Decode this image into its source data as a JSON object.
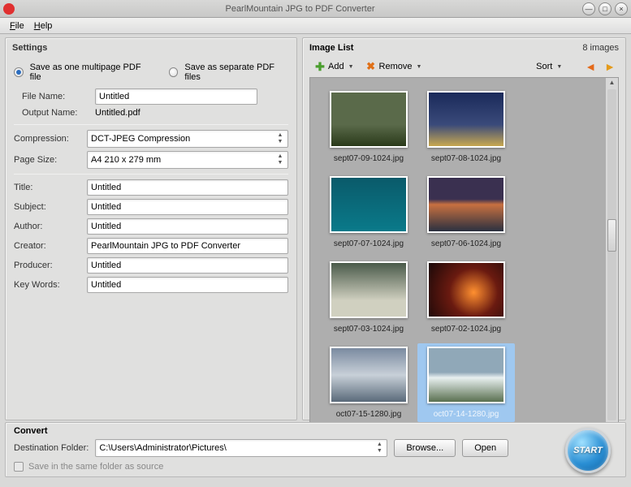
{
  "window": {
    "title": "PearlMountain JPG to PDF Converter"
  },
  "menu": {
    "file": "File",
    "help": "Help"
  },
  "settings": {
    "title": "Settings",
    "radio_multipage": "Save as one multipage PDF file",
    "radio_separate": "Save as separate PDF files",
    "filename_label": "File Name:",
    "filename_value": "Untitled",
    "outputname_label": "Output Name:",
    "outputname_value": "Untitled.pdf",
    "compression_label": "Compression:",
    "compression_value": "DCT-JPEG Compression",
    "pagesize_label": "Page Size:",
    "pagesize_value": "A4 210 x 279 mm",
    "title_label": "Title:",
    "title_value": "Untitled",
    "subject_label": "Subject:",
    "subject_value": "Untitled",
    "author_label": "Author:",
    "author_value": "Untitled",
    "creator_label": "Creator:",
    "creator_value": "PearlMountain JPG to PDF Converter",
    "producer_label": "Producer:",
    "producer_value": "Untitled",
    "keywords_label": "Key Words:",
    "keywords_value": "Untitled"
  },
  "imagelist": {
    "title": "Image List",
    "count": "8 images",
    "add": "Add",
    "remove": "Remove",
    "sort": "Sort",
    "items": [
      {
        "name": "sept07-09-1024.jpg"
      },
      {
        "name": "sept07-08-1024.jpg"
      },
      {
        "name": "sept07-07-1024.jpg"
      },
      {
        "name": "sept07-06-1024.jpg"
      },
      {
        "name": "sept07-03-1024.jpg"
      },
      {
        "name": "sept07-02-1024.jpg"
      },
      {
        "name": "oct07-15-1280.jpg"
      },
      {
        "name": "oct07-14-1280.jpg"
      }
    ]
  },
  "convert": {
    "title": "Convert",
    "destfolder_label": "Destination Folder:",
    "destfolder_value": "C:\\Users\\Administrator\\Pictures\\",
    "browse": "Browse...",
    "open": "Open",
    "savesame": "Save in the same folder as source",
    "start": "START"
  }
}
